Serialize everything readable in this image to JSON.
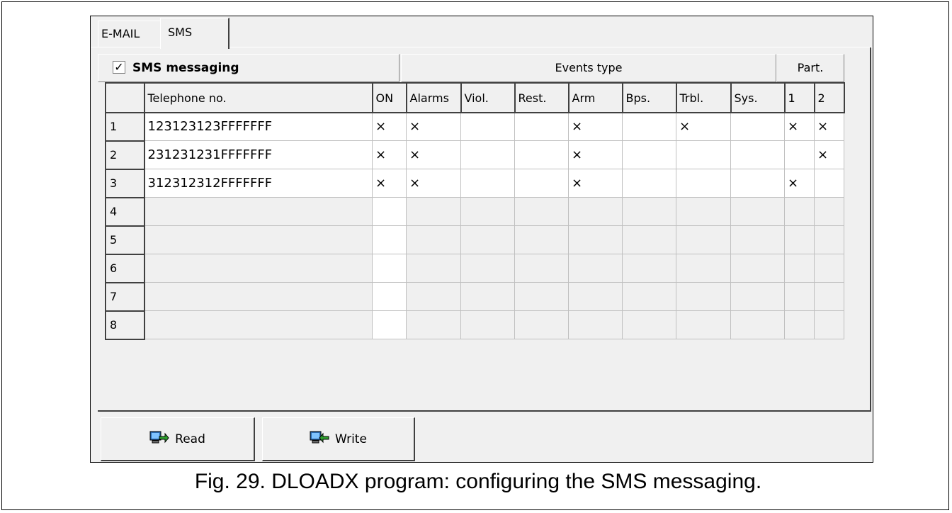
{
  "tabs": [
    "E-MAIL",
    "SMS"
  ],
  "sms_messaging": {
    "checked": true,
    "check_glyph": "✓",
    "label": "SMS messaging"
  },
  "group_headers": {
    "events": "Events type",
    "part": "Part."
  },
  "columns": [
    "",
    "Telephone no.",
    "ON",
    "Alarms",
    "Viol.",
    "Rest.",
    "Arm",
    "Bps.",
    "Trbl.",
    "Sys.",
    "1",
    "2"
  ],
  "rows": [
    {
      "n": "1",
      "phone": "123123123FFFFFFF",
      "cells": [
        "×",
        "×",
        "",
        "",
        "×",
        "",
        "×",
        "",
        "×",
        "×"
      ]
    },
    {
      "n": "2",
      "phone": "231231231FFFFFFF",
      "cells": [
        "×",
        "×",
        "",
        "",
        "×",
        "",
        "",
        "",
        "",
        "×"
      ]
    },
    {
      "n": "3",
      "phone": "312312312FFFFFFF",
      "cells": [
        "×",
        "×",
        "",
        "",
        "×",
        "",
        "",
        "",
        "×",
        ""
      ]
    },
    {
      "n": "4",
      "phone": "",
      "cells": [
        "",
        "",
        "",
        "",
        "",
        "",
        "",
        "",
        "",
        ""
      ]
    },
    {
      "n": "5",
      "phone": "",
      "cells": [
        "",
        "",
        "",
        "",
        "",
        "",
        "",
        "",
        "",
        ""
      ]
    },
    {
      "n": "6",
      "phone": "",
      "cells": [
        "",
        "",
        "",
        "",
        "",
        "",
        "",
        "",
        "",
        ""
      ]
    },
    {
      "n": "7",
      "phone": "",
      "cells": [
        "",
        "",
        "",
        "",
        "",
        "",
        "",
        "",
        "",
        ""
      ]
    },
    {
      "n": "8",
      "phone": "",
      "cells": [
        "",
        "",
        "",
        "",
        "",
        "",
        "",
        "",
        "",
        ""
      ]
    }
  ],
  "buttons": {
    "read": "Read",
    "write": "Write"
  },
  "icons": {
    "read": "read-icon",
    "write": "write-icon"
  },
  "caption": "Fig. 29. DLOADX program: configuring the SMS messaging."
}
